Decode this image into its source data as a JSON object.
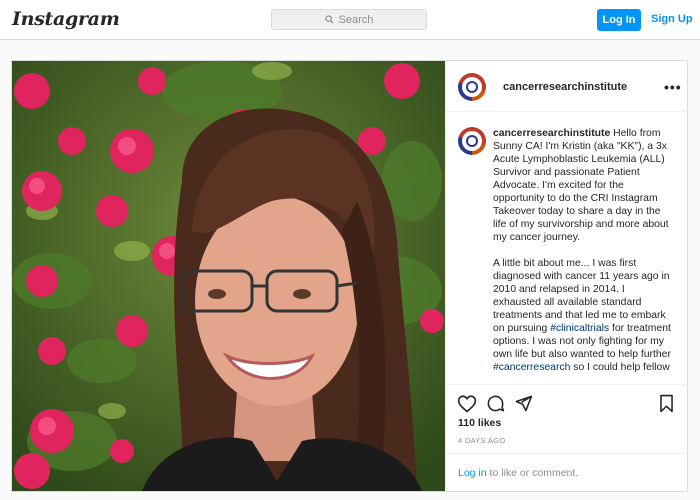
{
  "header": {
    "logo_text": "Instagram",
    "search_placeholder": "Search",
    "login_label": "Log In",
    "signup_label": "Sign Up"
  },
  "post": {
    "username": "cancerresearchinstitute",
    "more_label": "•••",
    "caption_user": "cancerresearchinstitute",
    "caption_p1": "Hello from Sunny CA! I'm Kristin (aka \"KK\"), a 3x Acute Lymphoblastic Leukemia (ALL) Survivor and passionate Patient Advocate. I'm excited for the opportunity to do the CRI Instagram Takeover today to share a day in the life of my survivorship and more about my cancer journey.",
    "caption_p2_a": "A little bit about me... I was first diagnosed with cancer 11 years ago in 2010 and relapsed in 2014. I exhausted all available standard treatments and that led me to embark on pursuing ",
    "hashtag_1": "#clinicaltrials",
    "caption_p2_b": " for treatment options. I was not only fighting for my own life but also wanted to help further ",
    "hashtag_2": "#cancerresearch",
    "caption_p2_c": " so I could help fellow",
    "likes": "110 likes",
    "time_ago": "4 DAYS AGO",
    "comment_login": "Log in",
    "comment_rest": " to like or comment.",
    "icons": [
      "heart-icon",
      "comment-icon",
      "share-icon",
      "bookmark-icon"
    ]
  },
  "colors": {
    "accent": "#0095f6",
    "hashtag": "#00376b",
    "border": "#dbdbdb"
  }
}
